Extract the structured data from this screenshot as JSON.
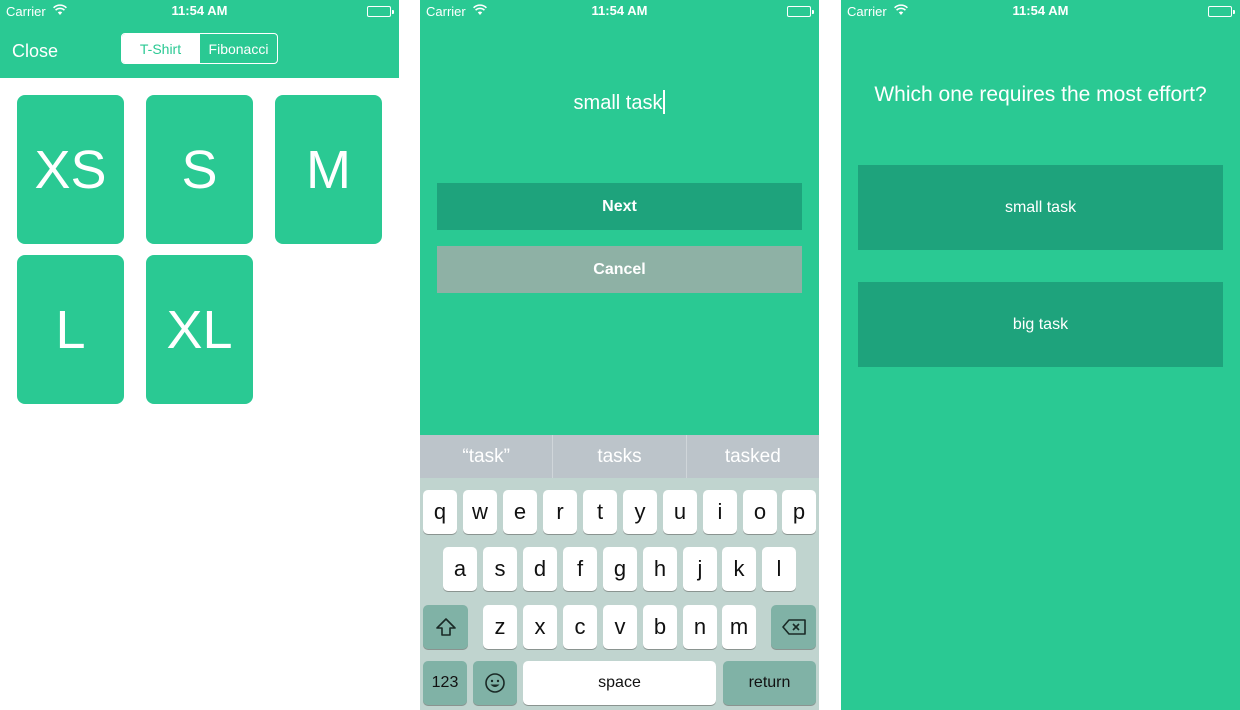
{
  "status_bar": {
    "carrier": "Carrier",
    "time": "11:54 AM"
  },
  "screen1": {
    "close_label": "Close",
    "segments": [
      "T-Shirt",
      "Fibonacci"
    ],
    "selected_segment": "T-Shirt",
    "sizes": [
      "XS",
      "S",
      "M",
      "L",
      "XL"
    ]
  },
  "screen2": {
    "input_value": "small task",
    "next_label": "Next",
    "cancel_label": "Cancel",
    "keyboard": {
      "suggestions": [
        "“task”",
        "tasks",
        "tasked"
      ],
      "row1": [
        "q",
        "w",
        "e",
        "r",
        "t",
        "y",
        "u",
        "i",
        "o",
        "p"
      ],
      "row2": [
        "a",
        "s",
        "d",
        "f",
        "g",
        "h",
        "j",
        "k",
        "l"
      ],
      "row3": [
        "z",
        "x",
        "c",
        "v",
        "b",
        "n",
        "m"
      ],
      "numbers_label": "123",
      "space_label": "space",
      "return_label": "return"
    }
  },
  "screen3": {
    "question": "Which one requires the most effort?",
    "choices": [
      "small task",
      "big task"
    ]
  },
  "colors": {
    "accent": "#2ac993",
    "button_dark": "#1ea37c",
    "cancel_gray": "#8eb1a5"
  }
}
